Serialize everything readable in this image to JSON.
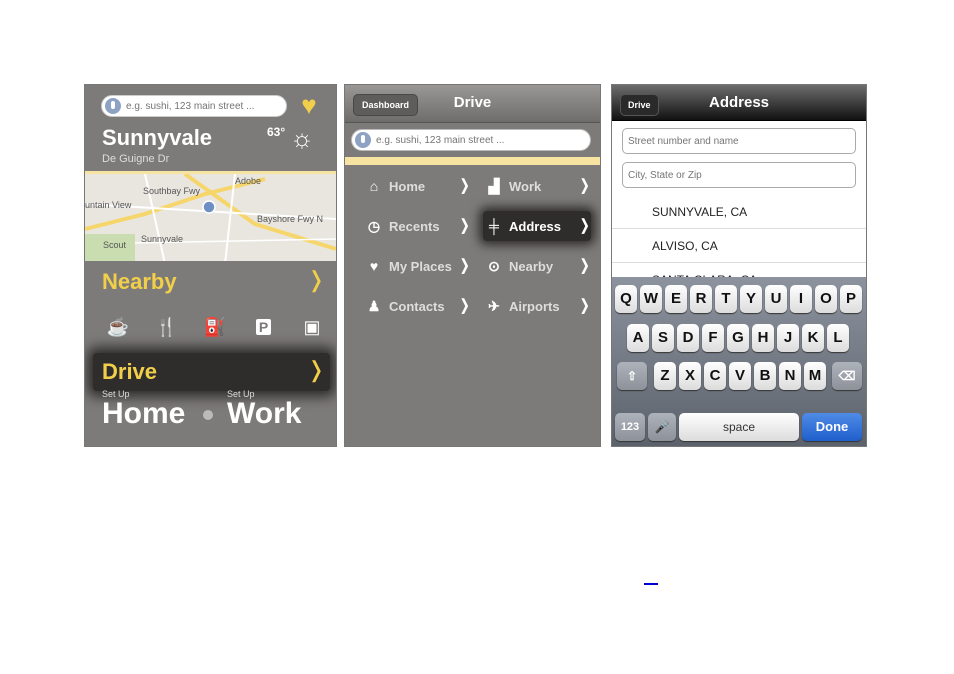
{
  "panel1": {
    "search_placeholder": "e.g. sushi, 123 main street ...",
    "city": "Sunnyvale",
    "street": "De Guigne Dr",
    "temperature": "63°",
    "map_labels": [
      "Southbay Fwy",
      "untain View",
      "Bayshore Fwy N",
      "Sunnyvale",
      "Scout",
      "Adobe"
    ],
    "nearby_label": "Nearby",
    "category_icons": [
      "coffee-icon",
      "restaurant-icon",
      "gas-pump-icon",
      "parking-icon",
      "atm-icon"
    ],
    "drive_label": "Drive",
    "setup_home_caption": "Set Up",
    "setup_work_caption": "Set Up",
    "home_label": "Home",
    "work_label": "Work",
    "accent_color": "#f2cf4a"
  },
  "panel2": {
    "back_button": "Dashboard",
    "title": "Drive",
    "search_placeholder": "e.g. sushi, 123 main street ...",
    "menu_left": [
      {
        "label": "Home",
        "icon": "home-icon"
      },
      {
        "label": "Recents",
        "icon": "clock-icon"
      },
      {
        "label": "My Places",
        "icon": "heart-icon"
      },
      {
        "label": "Contacts",
        "icon": "person-icon"
      }
    ],
    "menu_right": [
      {
        "label": "Work",
        "icon": "factory-icon"
      },
      {
        "label": "Address",
        "icon": "signpost-icon",
        "selected": true
      },
      {
        "label": "Nearby",
        "icon": "map-pin-icon"
      },
      {
        "label": "Airports",
        "icon": "airplane-icon"
      }
    ]
  },
  "panel3": {
    "back_button": "Drive",
    "title": "Address",
    "street_placeholder": "Street number and name",
    "city_placeholder": "City, State or Zip",
    "suggestions": [
      "SUNNYVALE, CA",
      "ALVISO, CA",
      "SANTA CLARA, CA"
    ],
    "keyboard": {
      "row1": [
        "Q",
        "W",
        "E",
        "R",
        "T",
        "Y",
        "U",
        "I",
        "O",
        "P"
      ],
      "row2": [
        "A",
        "S",
        "D",
        "F",
        "G",
        "H",
        "J",
        "K",
        "L"
      ],
      "row3": [
        "Z",
        "X",
        "C",
        "V",
        "B",
        "N",
        "M"
      ],
      "numbers_key": "123",
      "space_key": "space",
      "done_key": "Done",
      "done_color": "#1f5fcc"
    }
  }
}
